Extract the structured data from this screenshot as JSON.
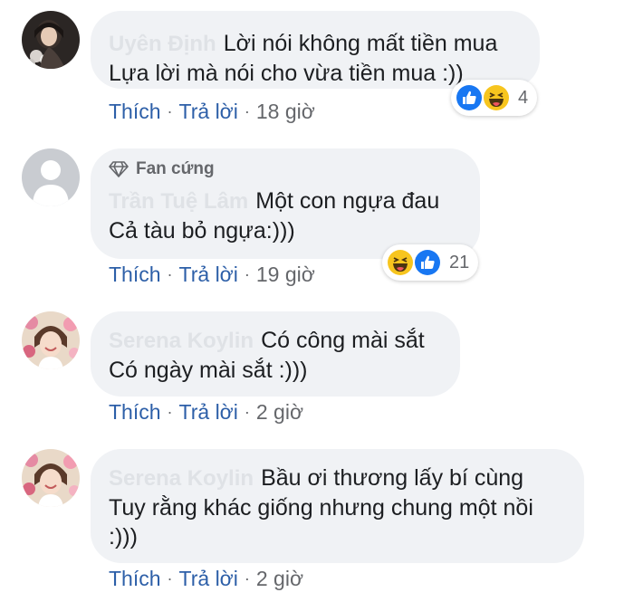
{
  "comments": [
    {
      "author": "Uyên Định",
      "badge": "",
      "text_lines": [
        "Lời nói không mất tiền mua",
        "Lựa lời mà nói cho vừa tiền mua :))"
      ],
      "actions": {
        "like": "Thích",
        "reply": "Trả lời",
        "time": "18 giờ"
      },
      "reactions": {
        "types": [
          "like",
          "haha"
        ],
        "count": "4"
      }
    },
    {
      "author": "Trần Tuệ Lâm",
      "badge": "Fan cứng",
      "text_lines": [
        "Một con ngựa đau",
        "Cả tàu bỏ ngựa:)))"
      ],
      "actions": {
        "like": "Thích",
        "reply": "Trả lời",
        "time": "19 giờ"
      },
      "reactions": {
        "types": [
          "haha",
          "like"
        ],
        "count": "21"
      }
    },
    {
      "author": "Serena Koylin",
      "badge": "",
      "text_lines": [
        "Có công mài sắt",
        "Có ngày mài sắt :)))"
      ],
      "actions": {
        "like": "Thích",
        "reply": "Trả lời",
        "time": "2 giờ"
      },
      "reactions": null
    },
    {
      "author": "Serena Koylin",
      "badge": "",
      "text_lines": [
        "Bầu ơi thương lấy bí cùng",
        "Tuy rằng khác giống nhưng chung một nồi",
        ":)))"
      ],
      "actions": {
        "like": "Thích",
        "reply": "Trả lời",
        "time": "2 giờ"
      },
      "reactions": null
    }
  ],
  "colors": {
    "bubble": "#f0f2f5",
    "action_link": "#2d5fa8",
    "meta_text": "#65676b",
    "like_blue": "#1877f2",
    "haha_yellow": "#f7c51e"
  },
  "icons": {
    "badge": "diamond-icon",
    "like": "like-reaction-icon",
    "haha": "haha-reaction-icon",
    "avatar_default": "default-avatar-icon"
  }
}
